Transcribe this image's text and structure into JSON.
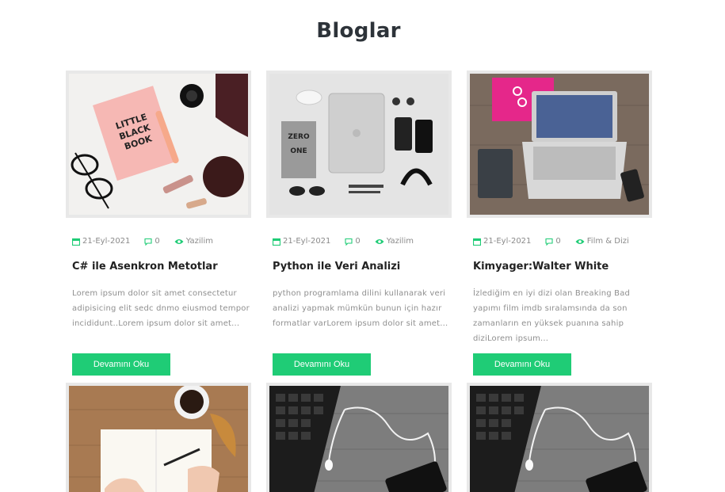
{
  "page": {
    "title": "Bloglar"
  },
  "posts": [
    {
      "date": "21-Eyl-2021",
      "comments": "0",
      "category": "Yazilim",
      "title": "C# ile Asenkron Metotlar",
      "excerpt": "Lorem ipsum dolor sit amet consectetur adipisicing elit sedc dnmo eiusmod tempor incididunt..Lorem ipsum dolor sit amet...",
      "button": "Devamını Oku"
    },
    {
      "date": "21-Eyl-2021",
      "comments": "0",
      "category": "Yazilim",
      "title": "Python ile Veri Analizi",
      "excerpt": "python programlama dilini kullanarak veri analizi yapmak mümkün bunun için hazır formatlar varLorem ipsum dolor sit amet...",
      "button": "Devamını Oku"
    },
    {
      "date": "21-Eyl-2021",
      "comments": "0",
      "category": "Film & Dizi",
      "title": "Kimyager:Walter White",
      "excerpt": "İzlediğim en iyi dizi olan Breaking Bad yapımı film imdb sıralamsında da son zamanların en yüksek puanına sahip diziLorem ipsum...",
      "button": "Devamını Oku"
    }
  ],
  "colors": {
    "accent": "#1fcc76",
    "title": "#2d3339"
  },
  "icons": {
    "date": "calendar-icon",
    "comments": "comment-icon",
    "category": "eye-icon"
  }
}
